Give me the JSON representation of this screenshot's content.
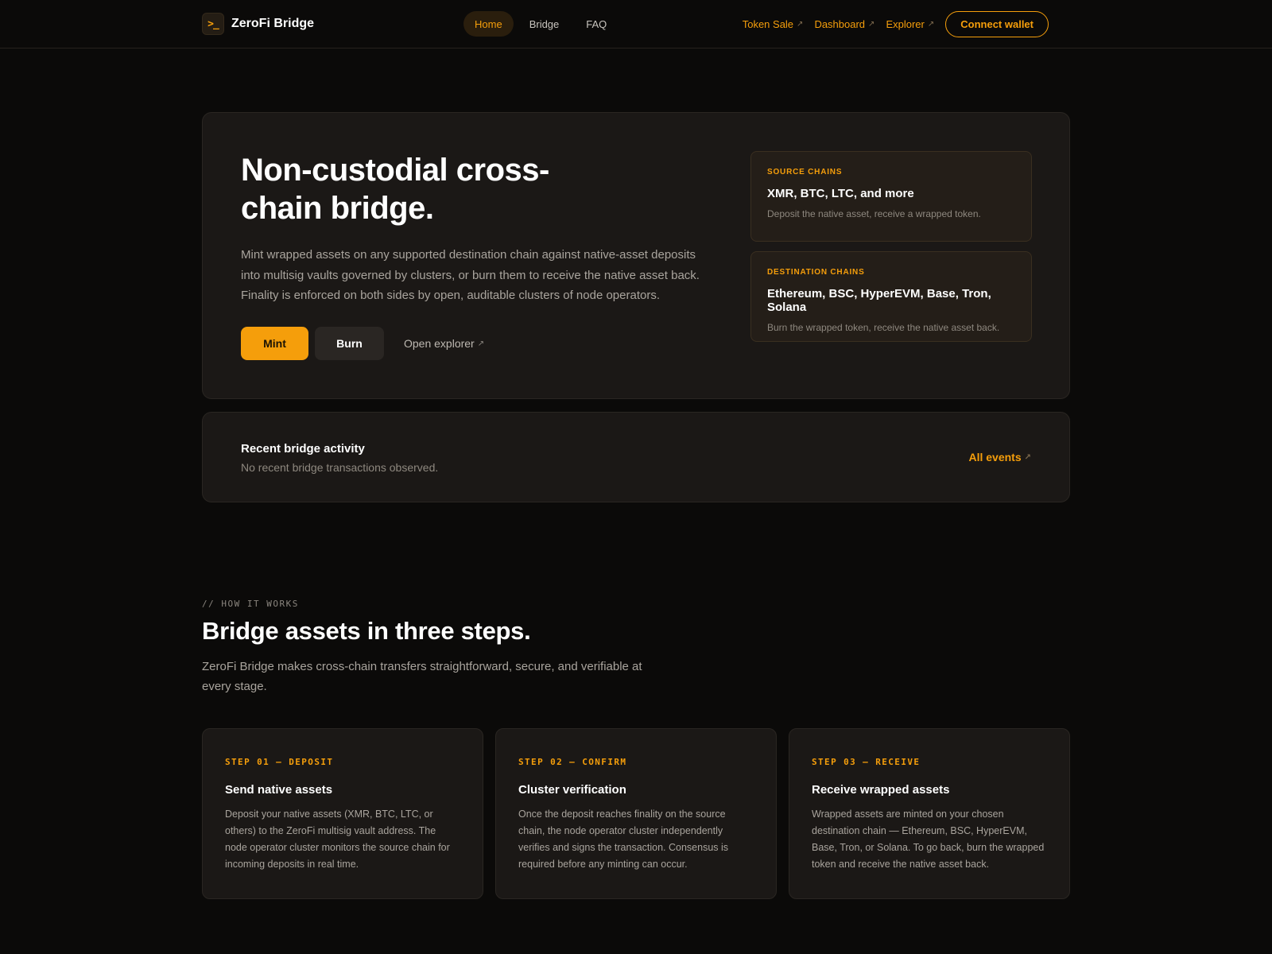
{
  "nav": {
    "logo_glyph": ">_",
    "brand": "ZeroFi Bridge",
    "links": [
      {
        "label": "Home",
        "active": true
      },
      {
        "label": "Bridge",
        "active": false
      },
      {
        "label": "FAQ",
        "active": false
      }
    ],
    "external_links": [
      {
        "label": "Token Sale",
        "icon": "external-arrow-icon"
      },
      {
        "label": "Dashboard",
        "icon": "external-arrow-icon"
      },
      {
        "label": "Explorer",
        "icon": "external-arrow-icon"
      }
    ],
    "arrow_glyph": "↗",
    "connect_label": "Connect wallet"
  },
  "hero": {
    "title": "Non-custodial cross-chain bridge.",
    "description": "Mint wrapped assets on any supported destination chain against native-asset deposits into multisig vaults governed by clusters, or burn them to receive the native asset back. Finality is enforced on both sides by open, auditable clusters of node operators.",
    "mint_label": "Mint",
    "burn_label": "Burn",
    "explorer_label": "Open explorer",
    "source": {
      "label": "SOURCE CHAINS",
      "title": "XMR, BTC, LTC, and more",
      "desc": "Deposit the native asset, receive a wrapped token."
    },
    "destination": {
      "label": "DESTINATION CHAINS",
      "title": "Ethereum, BSC, HyperEVM, Base, Tron, Solana",
      "desc": "Burn the wrapped token, receive the native asset back."
    }
  },
  "activity": {
    "title": "Recent bridge activity",
    "subtitle": "No recent bridge transactions observed.",
    "all_events_label": "All events"
  },
  "how": {
    "eyebrow": "// HOW IT WORKS",
    "title": "Bridge assets in three steps.",
    "description": "ZeroFi Bridge makes cross-chain transfers straightforward, secure, and verifiable at every stage.",
    "steps": [
      {
        "label": "STEP 01 — DEPOSIT",
        "title": "Send native assets",
        "desc": "Deposit your native assets (XMR, BTC, LTC, or others) to the ZeroFi multisig vault address. The node operator cluster monitors the source chain for incoming deposits in real time."
      },
      {
        "label": "STEP 02 — CONFIRM",
        "title": "Cluster verification",
        "desc": "Once the deposit reaches finality on the source chain, the node operator cluster independently verifies and signs the transaction. Consensus is required before any minting can occur."
      },
      {
        "label": "STEP 03 — RECEIVE",
        "title": "Receive wrapped assets",
        "desc": "Wrapped assets are minted on your chosen destination chain — Ethereum, BSC, HyperEVM, Base, Tron, or Solana. To go back, burn the wrapped token and receive the native asset back."
      }
    ]
  },
  "colors": {
    "accent": "#f59e0b",
    "background": "#0b0a09",
    "card": "#1b1816"
  }
}
